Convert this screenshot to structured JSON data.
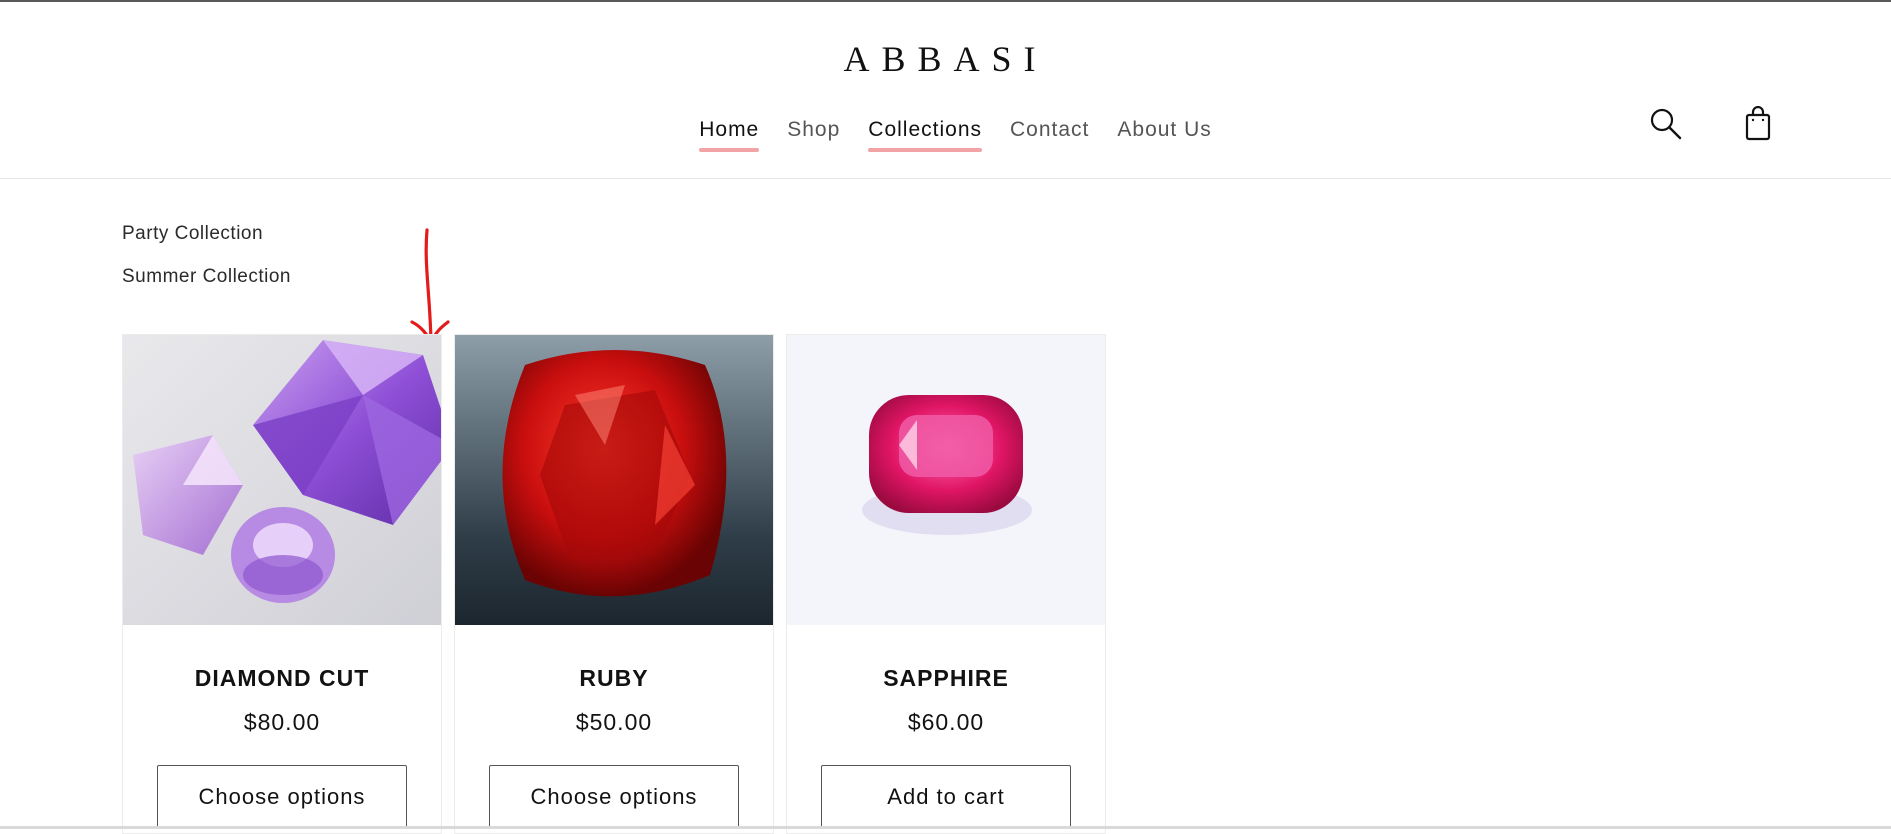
{
  "brand": {
    "logo": "ABBASI"
  },
  "nav": {
    "items": [
      {
        "label": "Home",
        "active": true
      },
      {
        "label": "Shop",
        "active": false
      },
      {
        "label": "Collections",
        "active": true
      },
      {
        "label": "Contact",
        "active": false
      },
      {
        "label": "About Us",
        "active": false
      }
    ]
  },
  "header_icons": [
    "search-icon",
    "shopping-bag-icon"
  ],
  "collections": [
    {
      "label": "Party Collection"
    },
    {
      "label": "Summer Collection"
    }
  ],
  "products": [
    {
      "title": "DIAMOND CUT",
      "price": "$80.00",
      "button": "Choose options",
      "image": "purple-gems-photo"
    },
    {
      "title": "RUBY",
      "price": "$50.00",
      "button": "Choose options",
      "image": "red-ruby-photo"
    },
    {
      "title": "SAPPHIRE",
      "price": "$60.00",
      "button": "Add to cart",
      "image": "pink-sapphire-photo"
    }
  ],
  "colors": {
    "nav_underline": "#f2a3a6",
    "annotation_arrow": "#e31b1b",
    "text": "#121212"
  }
}
